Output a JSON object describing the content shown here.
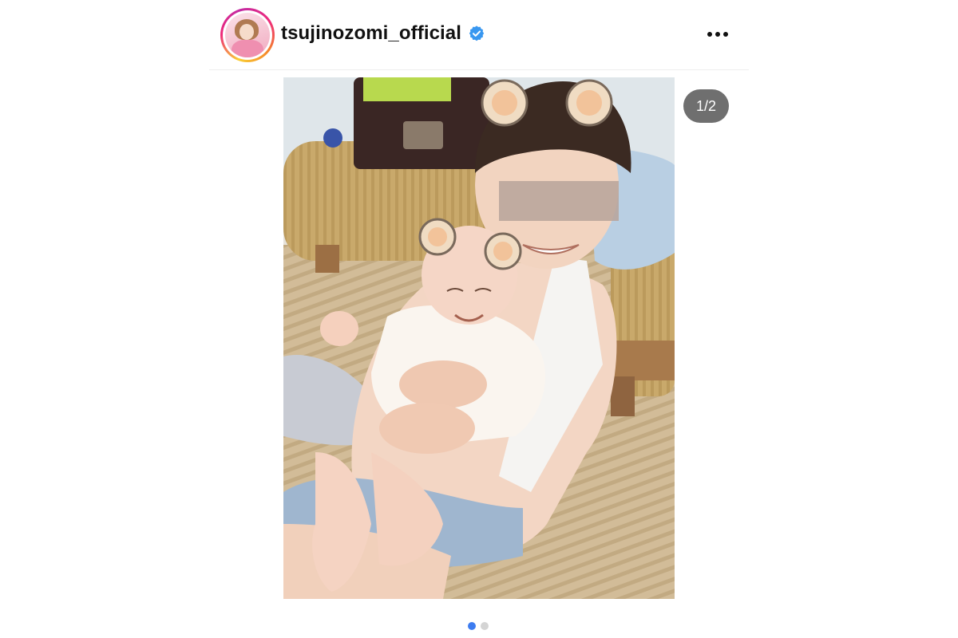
{
  "post": {
    "username": "tsujinozomi_official",
    "verified": true,
    "avatar_icon": "profile-photo",
    "more_icon": "more-horizontal-icon",
    "carousel": {
      "counter": "1/2",
      "current_index": 1,
      "total": 2
    },
    "colors": {
      "verified_blue": "#3897f0",
      "dot_active": "#3d7cf0",
      "dot_inactive": "#d4d4d4",
      "counter_bg": "#6f6f6f"
    }
  }
}
